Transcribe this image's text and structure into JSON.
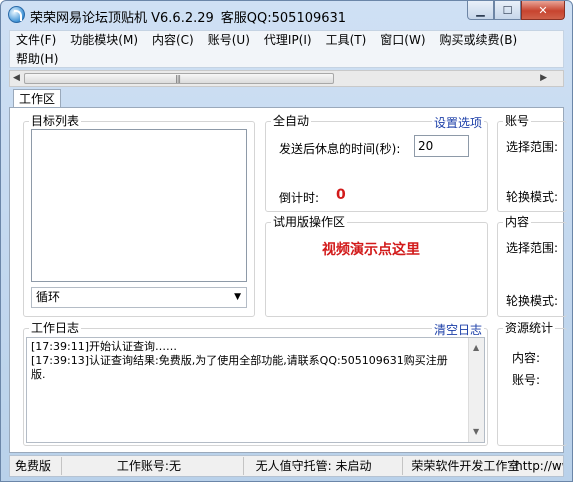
{
  "window": {
    "title": "荣荣网易论坛顶贴机 V6.6.2.29",
    "service": "客服QQ:505109631"
  },
  "menu": {
    "items": [
      "文件(F)",
      "功能模块(M)",
      "内容(C)",
      "账号(U)",
      "代理IP(I)",
      "工具(T)",
      "窗口(W)",
      "购买或续费(B)",
      "帮助(H)"
    ]
  },
  "tabs": {
    "workspace": "工作区"
  },
  "targets": {
    "title": "目标列表",
    "loop_value": "循环"
  },
  "auto": {
    "title": "全自动",
    "settings_link": "设置选项",
    "rest_label": "发送后休息的时间(秒):",
    "rest_value": "20",
    "countdown_label": "倒计时:",
    "countdown_value": "0"
  },
  "trial": {
    "title": "试用版操作区",
    "demo_link": "视频演示点这里"
  },
  "account_group": {
    "title": "账号",
    "range_label": "选择范围:",
    "rotate_label": "轮换模式:"
  },
  "content_group": {
    "title": "内容",
    "range_label": "选择范围:",
    "rotate_label": "轮换模式:"
  },
  "log": {
    "title": "工作日志",
    "clear_link": "清空日志",
    "lines": [
      "[17:39:11]开始认证查询……",
      "[17:39:13]认证查询结果:免费版,为了使用全部功能,请联系QQ:505109631购买注册版."
    ]
  },
  "resources": {
    "title": "资源统计",
    "content_label": "内容:",
    "account_label": "账号:"
  },
  "status": {
    "edition": "免费版",
    "work_account": "工作账号:无",
    "unattended": "无人值守托管: 未启动",
    "developer": "荣荣软件开发工作室",
    "url": "http://www"
  },
  "colors": {
    "accent_red": "#d21a1a",
    "link_blue": "#1c3fa8"
  }
}
